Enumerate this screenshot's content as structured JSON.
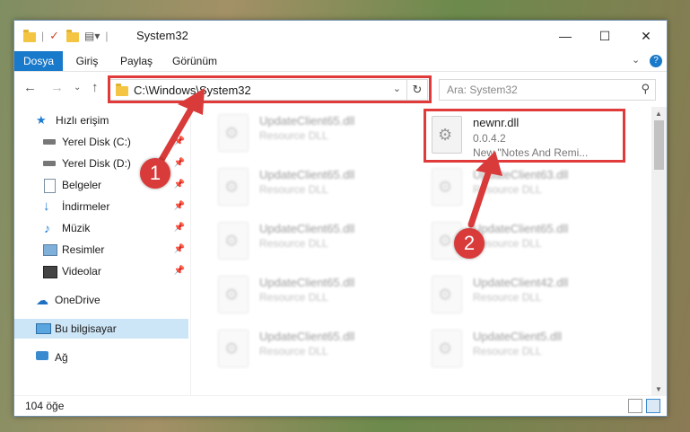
{
  "window": {
    "title": "System32",
    "controls": {
      "minimize": "—",
      "maximize": "☐",
      "close": "✕"
    }
  },
  "ribbon": {
    "tabs": [
      {
        "label": "Dosya",
        "active": true
      },
      {
        "label": "Giriş",
        "active": false
      },
      {
        "label": "Paylaş",
        "active": false
      },
      {
        "label": "Görünüm",
        "active": false
      }
    ],
    "expand_icon": "chevron-down-icon",
    "help_icon": "?"
  },
  "address_bar": {
    "path": "C:\\Windows\\System32",
    "refresh_icon": "↻"
  },
  "search": {
    "placeholder": "Ara: System32"
  },
  "sidebar": {
    "items": [
      {
        "label": "Hızlı erişim",
        "icon": "star-icon"
      },
      {
        "label": "Yerel Disk (C:)",
        "icon": "drive-icon",
        "pinned": true
      },
      {
        "label": "Yerel Disk (D:)",
        "icon": "drive-icon",
        "pinned": true
      },
      {
        "label": "Belgeler",
        "icon": "documents-icon",
        "pinned": true
      },
      {
        "label": "İndirmeler",
        "icon": "download-icon",
        "pinned": true
      },
      {
        "label": "Müzik",
        "icon": "music-icon",
        "pinned": true
      },
      {
        "label": "Resimler",
        "icon": "pictures-icon",
        "pinned": true
      },
      {
        "label": "Videolar",
        "icon": "videos-icon",
        "pinned": true
      },
      {
        "label": "OneDrive",
        "icon": "cloud-icon"
      },
      {
        "label": "Bu bilgisayar",
        "icon": "computer-icon",
        "selected": true
      },
      {
        "label": "Ağ",
        "icon": "network-icon"
      }
    ]
  },
  "files": [
    {
      "name": "UpdateClient65.dll",
      "type": "Resource DLL",
      "blurred": true
    },
    {
      "name": "newnr.dll",
      "version": "0.0.4.2",
      "description": "New \"Notes And Remi...",
      "blurred": false
    },
    {
      "name": "UpdateClient65.dll",
      "type": "Resource DLL",
      "blurred": true
    },
    {
      "name": "UpdateClient63.dll",
      "type": "Resource DLL",
      "blurred": true
    },
    {
      "name": "UpdateClient65.dll",
      "type": "Resource DLL",
      "blurred": true
    },
    {
      "name": "UpdateClient65.dll",
      "type": "Resource DLL",
      "blurred": true
    },
    {
      "name": "UpdateClient65.dll",
      "type": "Resource DLL",
      "blurred": true
    },
    {
      "name": "UpdateClient42.dll",
      "type": "Resource DLL",
      "blurred": true
    },
    {
      "name": "UpdateClient65.dll",
      "type": "Resource DLL",
      "blurred": true
    },
    {
      "name": "UpdateClient5.dll",
      "type": "Resource DLL",
      "blurred": true
    }
  ],
  "status": {
    "item_count": "104 öğe"
  },
  "annotations": {
    "step1": "1",
    "step2": "2",
    "color": "#d93a3a"
  }
}
